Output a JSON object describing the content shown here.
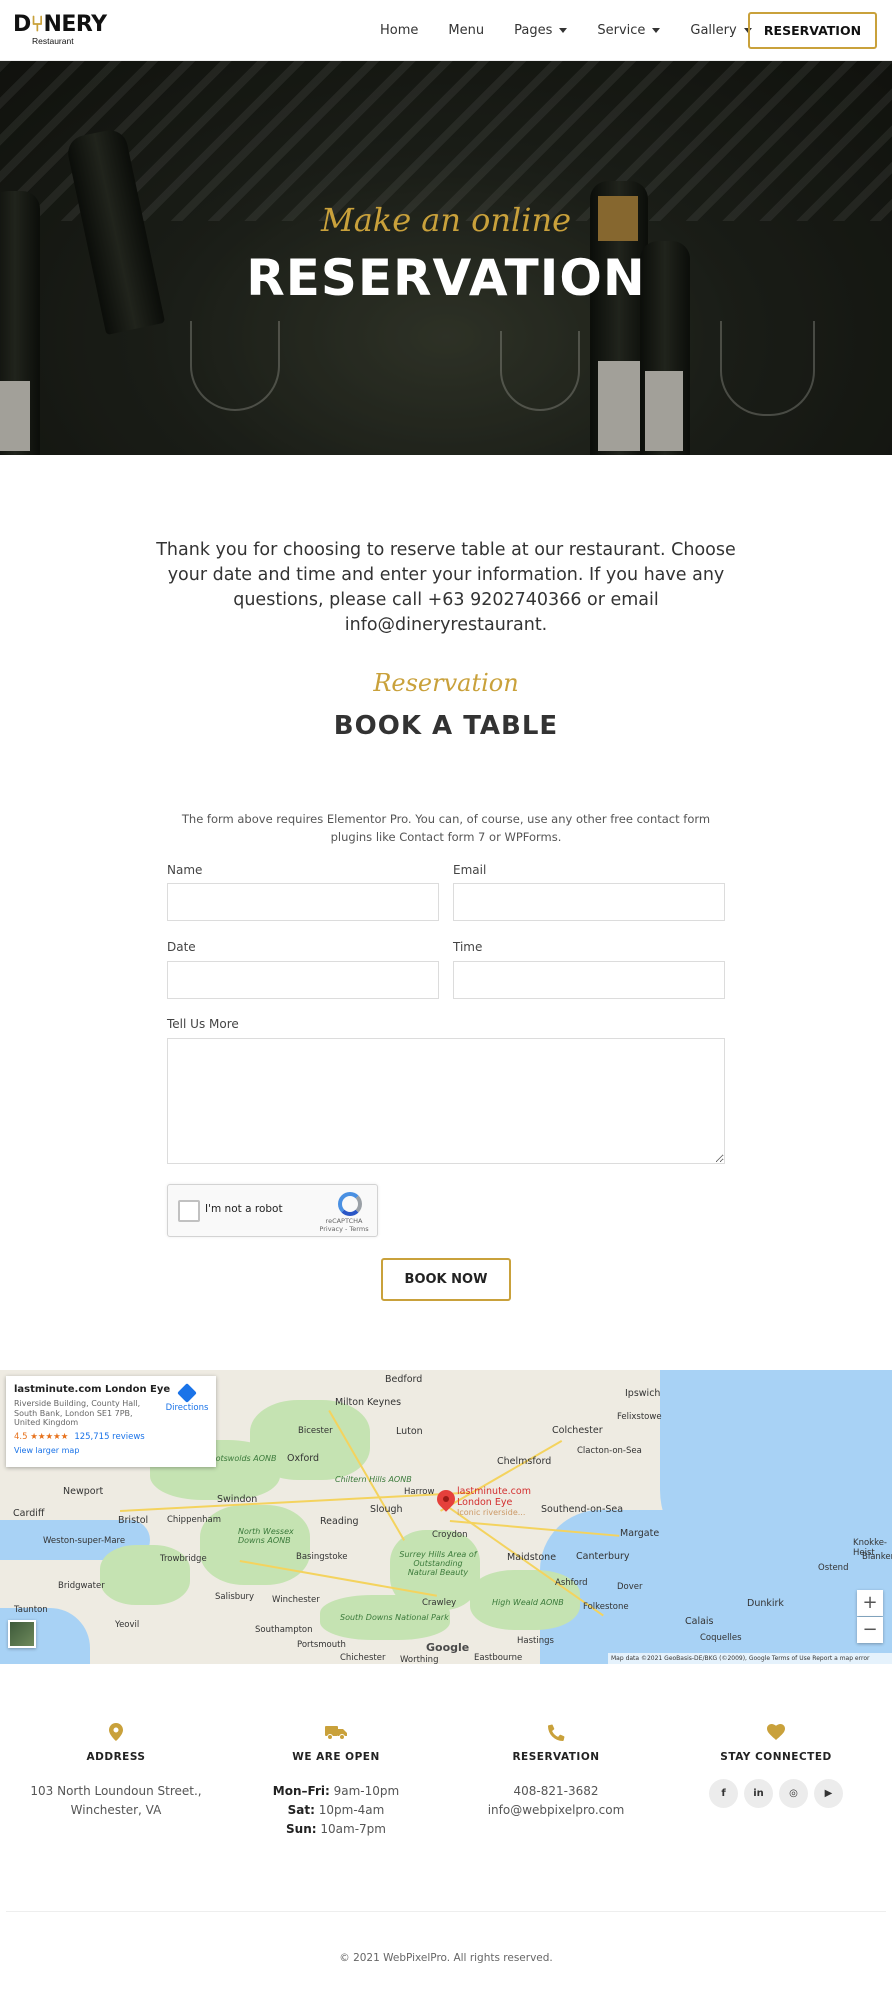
{
  "header": {
    "logo_main_a": "D",
    "logo_main_b": "NERY",
    "logo_sub": "Restaurant",
    "nav": [
      {
        "label": "Home"
      },
      {
        "label": "Menu"
      },
      {
        "label": "Pages"
      },
      {
        "label": "Service"
      },
      {
        "label": "Gallery"
      }
    ],
    "cta_label": "RESERVATION"
  },
  "hero": {
    "script": "Make an online",
    "title": "RESERVATION"
  },
  "intro": "Thank you for choosing to reserve table at our restaurant. Choose your date and time and enter your information. If you have any questions, please call +63 9202740366 or email info@dineryrestaurant.",
  "booking": {
    "script": "Reservation",
    "title": "BOOK A TABLE",
    "note": "The form above requires Elementor Pro. You can, of course, use any other free contact form plugins like Contact form 7 or WPForms.",
    "labels": {
      "name": "Name",
      "email": "Email",
      "date": "Date",
      "time": "Time",
      "message": "Tell Us More"
    },
    "values": {
      "name": "",
      "email": "",
      "date": "",
      "time": "",
      "message": ""
    },
    "captcha_text": "I'm not a robot",
    "captcha_brand": "reCAPTCHA",
    "captcha_links": "Privacy - Terms",
    "submit_label": "BOOK NOW"
  },
  "map": {
    "card_title": "lastminute.com London Eye",
    "card_address": "Riverside Building, County Hall, South Bank, London SE1 7PB, United Kingdom",
    "card_rating": "4.5 ★★★★★",
    "card_reviews": "125,715 reviews",
    "card_larger": "View larger map",
    "card_directions": "Directions",
    "pin_label_1": "lastminute.com",
    "pin_label_2": "London Eye",
    "pin_label_3": "Iconic riverside...",
    "zoom_in": "+",
    "zoom_out": "−",
    "google": "Google",
    "attribution": "Map data ©2021 GeoBasis-DE/BKG (©2009), Google   Terms of Use   Report a map error",
    "places": [
      "Bedford",
      "Ipswich",
      "Milton Keynes",
      "Felixstowe",
      "Bicester",
      "Luton",
      "Colchester",
      "Oxford",
      "Chelmsford",
      "Clacton-on-Sea",
      "Chiltern Hills AONB",
      "Harrow",
      "Newport",
      "Swindon",
      "Slough",
      "Southend-on-Sea",
      "Cardiff",
      "Bristol",
      "Chippenham",
      "Reading",
      "Weston-super-Mare",
      "North Wessex Downs AONB",
      "Croydon",
      "Margate",
      "Trowbridge",
      "Basingstoke",
      "Maidstone",
      "Canterbury",
      "Surrey Hills Area of Outstanding Natural Beauty",
      "Ashford",
      "Dover",
      "Bridgwater",
      "Salisbury",
      "Winchester",
      "Crawley",
      "High Weald AONB",
      "Folkestone",
      "Taunton",
      "Yeovil",
      "South Downs National Park",
      "Southampton",
      "Calais",
      "Dunkirk",
      "Portsmouth",
      "Chichester",
      "Hastings",
      "Eastbourne",
      "Worthing",
      "Knokke-Heist",
      "Ostend",
      "Blankenberge",
      "Coquelles",
      "Cotswolds AONB"
    ]
  },
  "info": {
    "address": {
      "title": "ADDRESS",
      "line1": "103 North Loundoun Street.,",
      "line2": "Winchester, VA"
    },
    "hours": {
      "title": "WE ARE OPEN",
      "rows": [
        {
          "day": "Mon–Fri:",
          "time": "9am-10pm"
        },
        {
          "day": "Sat:",
          "time": "10pm-4am"
        },
        {
          "day": "Sun:",
          "time": "10am-7pm"
        }
      ]
    },
    "reservation": {
      "title": "RESERVATION",
      "phone": "408-821-3682",
      "email": "info@webpixelpro.com"
    },
    "social": {
      "title": "STAY CONNECTED",
      "icons": [
        "f",
        "in",
        "◎",
        "▶"
      ]
    }
  },
  "footer": {
    "copyright": "© 2021 WebPixelPro. All rights reserved."
  },
  "colors": {
    "accent": "#c9a13b",
    "text": "#333333",
    "water": "#a8d2f5",
    "pin": "#e5403b"
  },
  "icons": {
    "address": "map-pin-icon",
    "hours": "truck-icon",
    "reservation": "phone-icon",
    "social": "heart-icon"
  }
}
